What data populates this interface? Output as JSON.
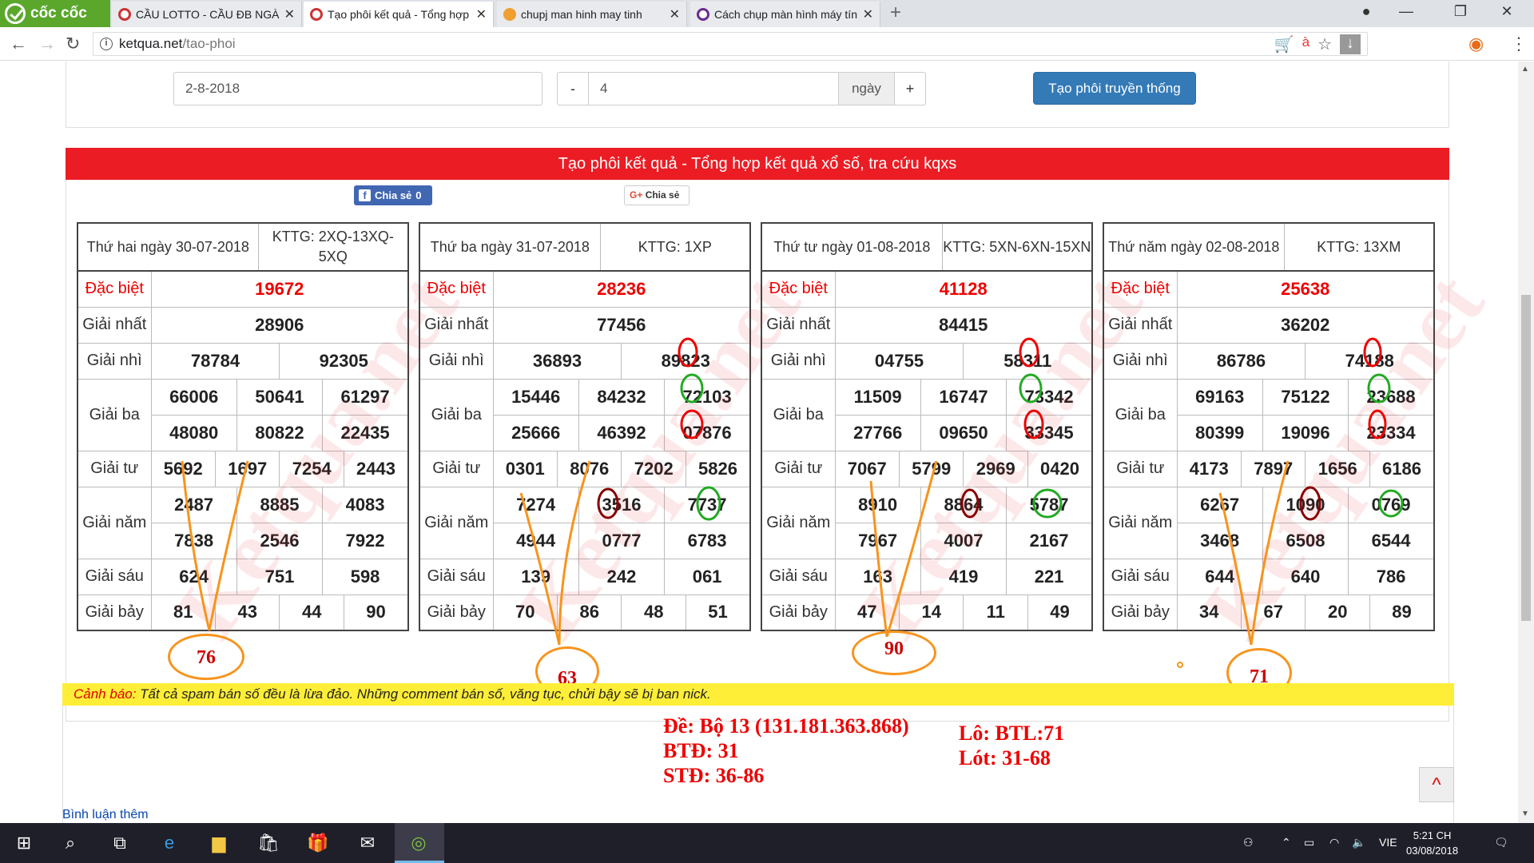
{
  "browser": {
    "brand": "cốc cốc",
    "tabs": [
      {
        "title": "CẦU LOTTO - CẦU ĐB NGÀY",
        "active": false
      },
      {
        "title": "Tạo phôi kết quả - Tổng hợp",
        "active": true
      },
      {
        "title": "chupj man hinh may tinh",
        "active": false
      },
      {
        "title": "Cách chụp màn hình máy tính",
        "active": false
      }
    ],
    "url_host": "ketqua.net",
    "url_path": "/tao-phoi"
  },
  "form": {
    "date_value": "2-8-2018",
    "minus_label": "-",
    "days_value": "4",
    "days_unit": "ngày",
    "plus_label": "+",
    "create_button": "Tạo phôi truyền thống"
  },
  "banner": "Tạo phôi kết quả - Tổng hợp kết quả xổ số, tra cứu kqxs",
  "share": {
    "facebook": "Chia sẻ",
    "facebook_count": "0",
    "google_g": "G+",
    "google": "Chia sẻ"
  },
  "watermark": "Ketqua.net",
  "labels": {
    "db": "Đặc biệt",
    "g1": "Giải nhất",
    "g2": "Giải nhì",
    "g3": "Giải ba",
    "g4": "Giải tư",
    "g5": "Giải năm",
    "g6": "Giải sáu",
    "g7": "Giải bảy"
  },
  "results": [
    {
      "day_title": "Thứ hai ngày 30-07-2018",
      "kttg": "KTTG: 2XQ-13XQ-5XQ",
      "db": "19672",
      "g1": "28906",
      "g2": [
        "78784",
        "92305"
      ],
      "g3": [
        "66006",
        "50641",
        "61297",
        "48080",
        "80822",
        "22435"
      ],
      "g4": [
        "5692",
        "1697",
        "7254",
        "2443"
      ],
      "g5": [
        "2487",
        "8885",
        "4083",
        "7838",
        "2546",
        "7922"
      ],
      "g6": [
        "624",
        "751",
        "598"
      ],
      "g7": [
        "81",
        "43",
        "44",
        "90"
      ]
    },
    {
      "day_title": "Thứ ba ngày 31-07-2018",
      "kttg": "KTTG: 1XP",
      "db": "28236",
      "g1": "77456",
      "g2": [
        "36893",
        "89823"
      ],
      "g3": [
        "15446",
        "84232",
        "72103",
        "25666",
        "46392",
        "07876"
      ],
      "g4": [
        "0301",
        "8076",
        "7202",
        "5826"
      ],
      "g5": [
        "7274",
        "3516",
        "7737",
        "4944",
        "0777",
        "6783"
      ],
      "g6": [
        "139",
        "242",
        "061"
      ],
      "g7": [
        "70",
        "86",
        "48",
        "51"
      ]
    },
    {
      "day_title": "Thứ tư ngày 01-08-2018",
      "kttg": "KTTG: 5XN-6XN-15XN",
      "db": "41128",
      "g1": "84415",
      "g2": [
        "04755",
        "58311"
      ],
      "g3": [
        "11509",
        "16747",
        "73342",
        "27766",
        "09650",
        "33345"
      ],
      "g4": [
        "7067",
        "5799",
        "2969",
        "0420"
      ],
      "g5": [
        "8910",
        "8864",
        "5787",
        "7967",
        "4007",
        "2167"
      ],
      "g6": [
        "163",
        "419",
        "221"
      ],
      "g7": [
        "47",
        "14",
        "11",
        "49"
      ]
    },
    {
      "day_title": "Thứ năm ngày 02-08-2018",
      "kttg": "KTTG: 13XM",
      "db": "25638",
      "g1": "36202",
      "g2": [
        "86786",
        "74188"
      ],
      "g3": [
        "69163",
        "75122",
        "23688",
        "80399",
        "19096",
        "23334"
      ],
      "g4": [
        "4173",
        "7897",
        "1656",
        "6186"
      ],
      "g5": [
        "6267",
        "1090",
        "0769",
        "3468",
        "6508",
        "6544"
      ],
      "g6": [
        "644",
        "640",
        "786"
      ],
      "g7": [
        "34",
        "67",
        "20",
        "89"
      ]
    }
  ],
  "annotations": [
    "76",
    "63",
    "90",
    "71"
  ],
  "warning": {
    "label": "Cảnh báo:",
    "text": " Tất cả spam bán số đều là lừa đảo. Những comment bán số, văng tục, chửi bậy sẽ bị ban nick."
  },
  "notes": {
    "de": "Đề: Bộ 13 (131.181.363.868)",
    "btd": "BTĐ: 31",
    "std": "STĐ: 36-86",
    "lo": "Lô: BTL:71",
    "lot": "Lót: 31-68"
  },
  "more_comments": "Bình luận thêm",
  "back_to_top": "^",
  "taskbar": {
    "language": "VIE",
    "time": "5:21 CH",
    "date": "03/08/2018"
  },
  "colors": {
    "banner_red": "#ec1c24",
    "button_blue": "#337ab7",
    "warning_yellow": "#ffee37",
    "annotation_orange": "#f7941d",
    "brand_green": "#5aa72c"
  }
}
